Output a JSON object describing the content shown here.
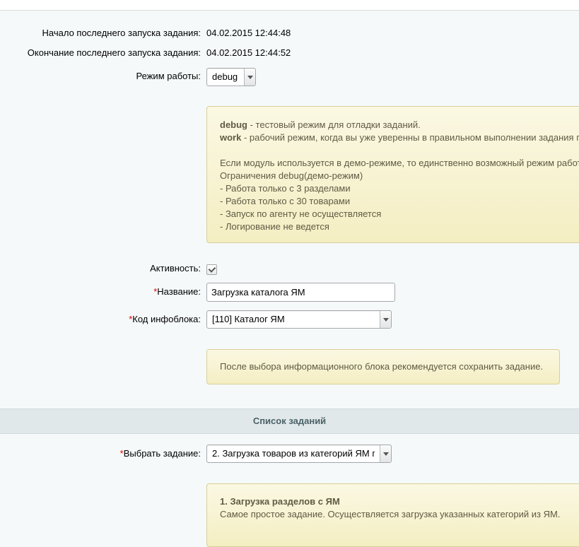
{
  "last_run": {
    "start_label": "Начало последнего запуска задания:",
    "start_value": "04.02.2015 12:44:48",
    "end_label": "Окончание последнего запуска задания:",
    "end_value": "04.02.2015 12:44:52"
  },
  "mode": {
    "label": "Режим работы:",
    "value": "debug"
  },
  "mode_note": {
    "debug_term": "debug",
    "debug_desc": " - тестовый режим для отладки заданий.",
    "work_term": "work",
    "work_desc": " - рабочий режим, когда вы уже уверенны в правильном выполнении задания п",
    "demo_line": "Если модуль используется в демо-режиме, то единственно возможный режим работ",
    "limits_title": "Ограничения debug(демо-режим)",
    "limits": [
      "- Работа только с 3 разделами",
      "- Работа только с 30 товарами",
      "- Запуск по агенту не осуществляется",
      "- Логирование не ведется"
    ]
  },
  "active": {
    "label": "Активность:",
    "checked": true
  },
  "name": {
    "required_mark": "*",
    "label": "Название:",
    "value": "Загрузка каталога ЯМ"
  },
  "iblock": {
    "required_mark": "*",
    "label": "Код инфоблока:",
    "value": "[110] Каталог ЯМ"
  },
  "iblock_note": "После выбора информационного блока рекомендуется сохранить задание.",
  "task_list": {
    "heading": "Список заданий",
    "required_mark": "*",
    "label": "Выбрать задание:",
    "value": "2. Загрузка товаров из категорий ЯМ п"
  },
  "task_note": {
    "title": "1. Загрузка разделов с ЯМ",
    "desc": "Самое простое задание. Осуществляется загрузка указанных категорий из ЯМ."
  }
}
